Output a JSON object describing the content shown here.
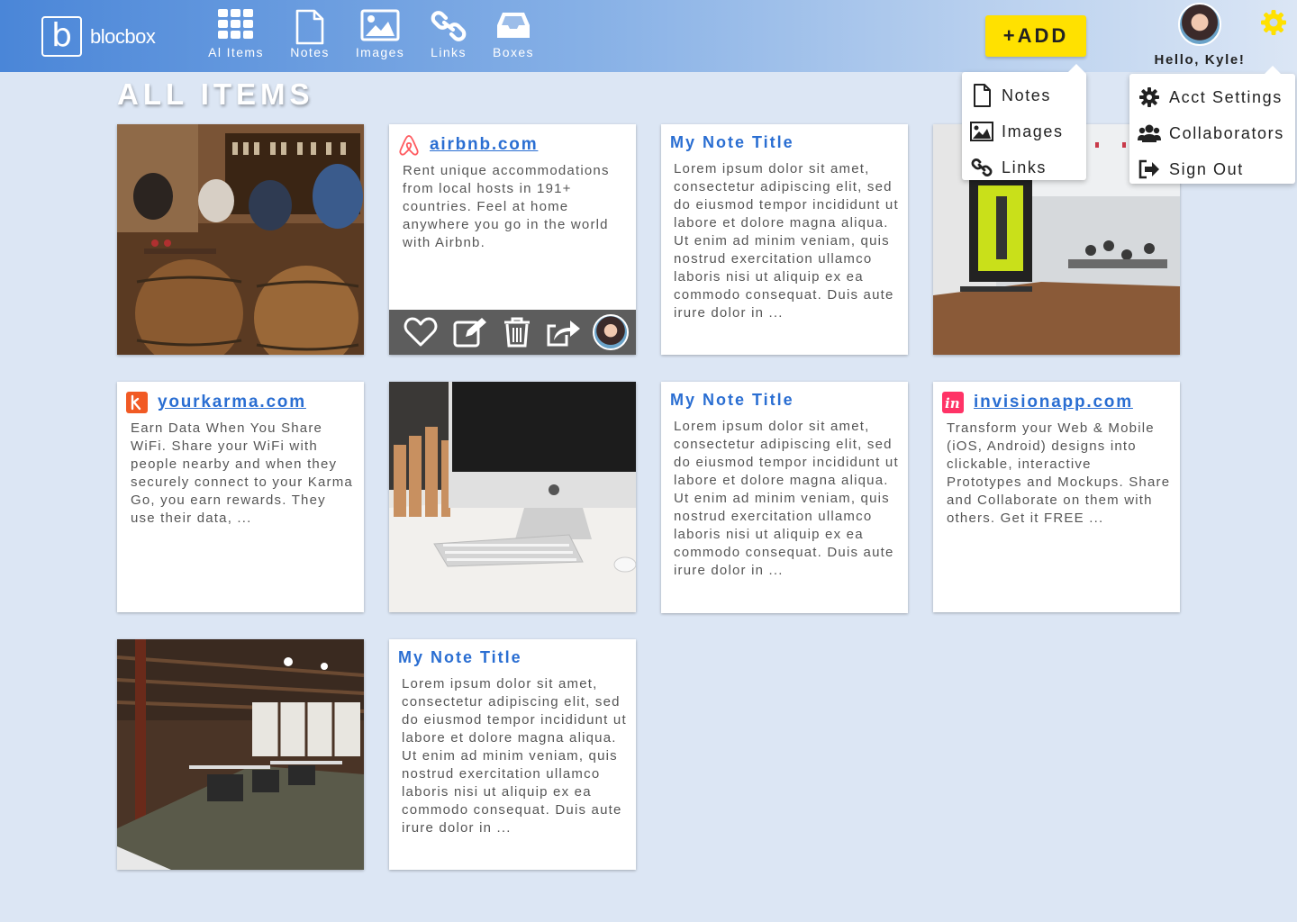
{
  "app": {
    "logo_letter": "b",
    "name": "blocbox"
  },
  "nav": [
    {
      "label": "Al Items",
      "icon": "grid-icon"
    },
    {
      "label": "Notes",
      "icon": "document-icon"
    },
    {
      "label": "Images",
      "icon": "image-icon"
    },
    {
      "label": "Links",
      "icon": "link-icon"
    },
    {
      "label": "Boxes",
      "icon": "inbox-icon"
    }
  ],
  "add_button": {
    "label": "+ADD"
  },
  "add_menu": [
    {
      "label": "Notes",
      "icon": "document-icon"
    },
    {
      "label": "Images",
      "icon": "image-icon"
    },
    {
      "label": "Links",
      "icon": "link-icon"
    }
  ],
  "user": {
    "greeting": "Hello, Kyle!"
  },
  "user_menu": [
    {
      "label": "Acct Settings",
      "icon": "gear-icon"
    },
    {
      "label": "Collaborators",
      "icon": "users-icon"
    },
    {
      "label": "Sign Out",
      "icon": "sign-out-icon"
    }
  ],
  "page": {
    "title": "ALL ITEMS"
  },
  "cards": {
    "airbnb": {
      "title": "airbnb.com",
      "body": "Rent unique accommodations from local hosts in 191+ countries. Feel at home anywhere you go in the world with Airbnb."
    },
    "note1": {
      "title": "My Note Title",
      "body": "Lorem ipsum dolor sit amet, consectetur adipiscing elit, sed do eiusmod tempor incididunt ut labore et dolore magna aliqua. Ut enim ad minim veniam, quis nostrud exercitation ullamco laboris nisi ut aliquip ex ea commodo consequat. Duis aute irure dolor in ..."
    },
    "yourkarma": {
      "title": "yourkarma.com",
      "body": "Earn Data When You Share WiFi. Share your WiFi with people nearby and when they securely connect to your Karma Go, you earn rewards. They use their data, ..."
    },
    "note2": {
      "title": "My Note Title",
      "body": "Lorem ipsum dolor sit amet, consectetur adipiscing elit, sed do eiusmod tempor incididunt ut labore et dolore magna aliqua. Ut enim ad minim veniam, quis nostrud exercitation ullamco laboris nisi ut aliquip ex ea commodo consequat. Duis aute irure dolor in ..."
    },
    "invision": {
      "title": "invisionapp.com",
      "body": "Transform your Web & Mobile (iOS, Android) designs into clickable, interactive Prototypes and Mockups. Share and Collaborate on them with others. Get it FREE ..."
    },
    "note3": {
      "title": "My Note Title",
      "body": "Lorem ipsum dolor sit amet, consectetur adipiscing elit, sed do eiusmod tempor incididunt ut labore et dolore magna aliqua. Ut enim ad minim veniam, quis nostrud exercitation ullamco laboris nisi ut aliquip ex ea commodo consequat. Duis aute irure dolor in ..."
    }
  },
  "colors": {
    "accent": "#2a6ed2",
    "add_button": "#ffe100",
    "background": "#dce6f4",
    "action_bar": "#5d5d5d"
  }
}
